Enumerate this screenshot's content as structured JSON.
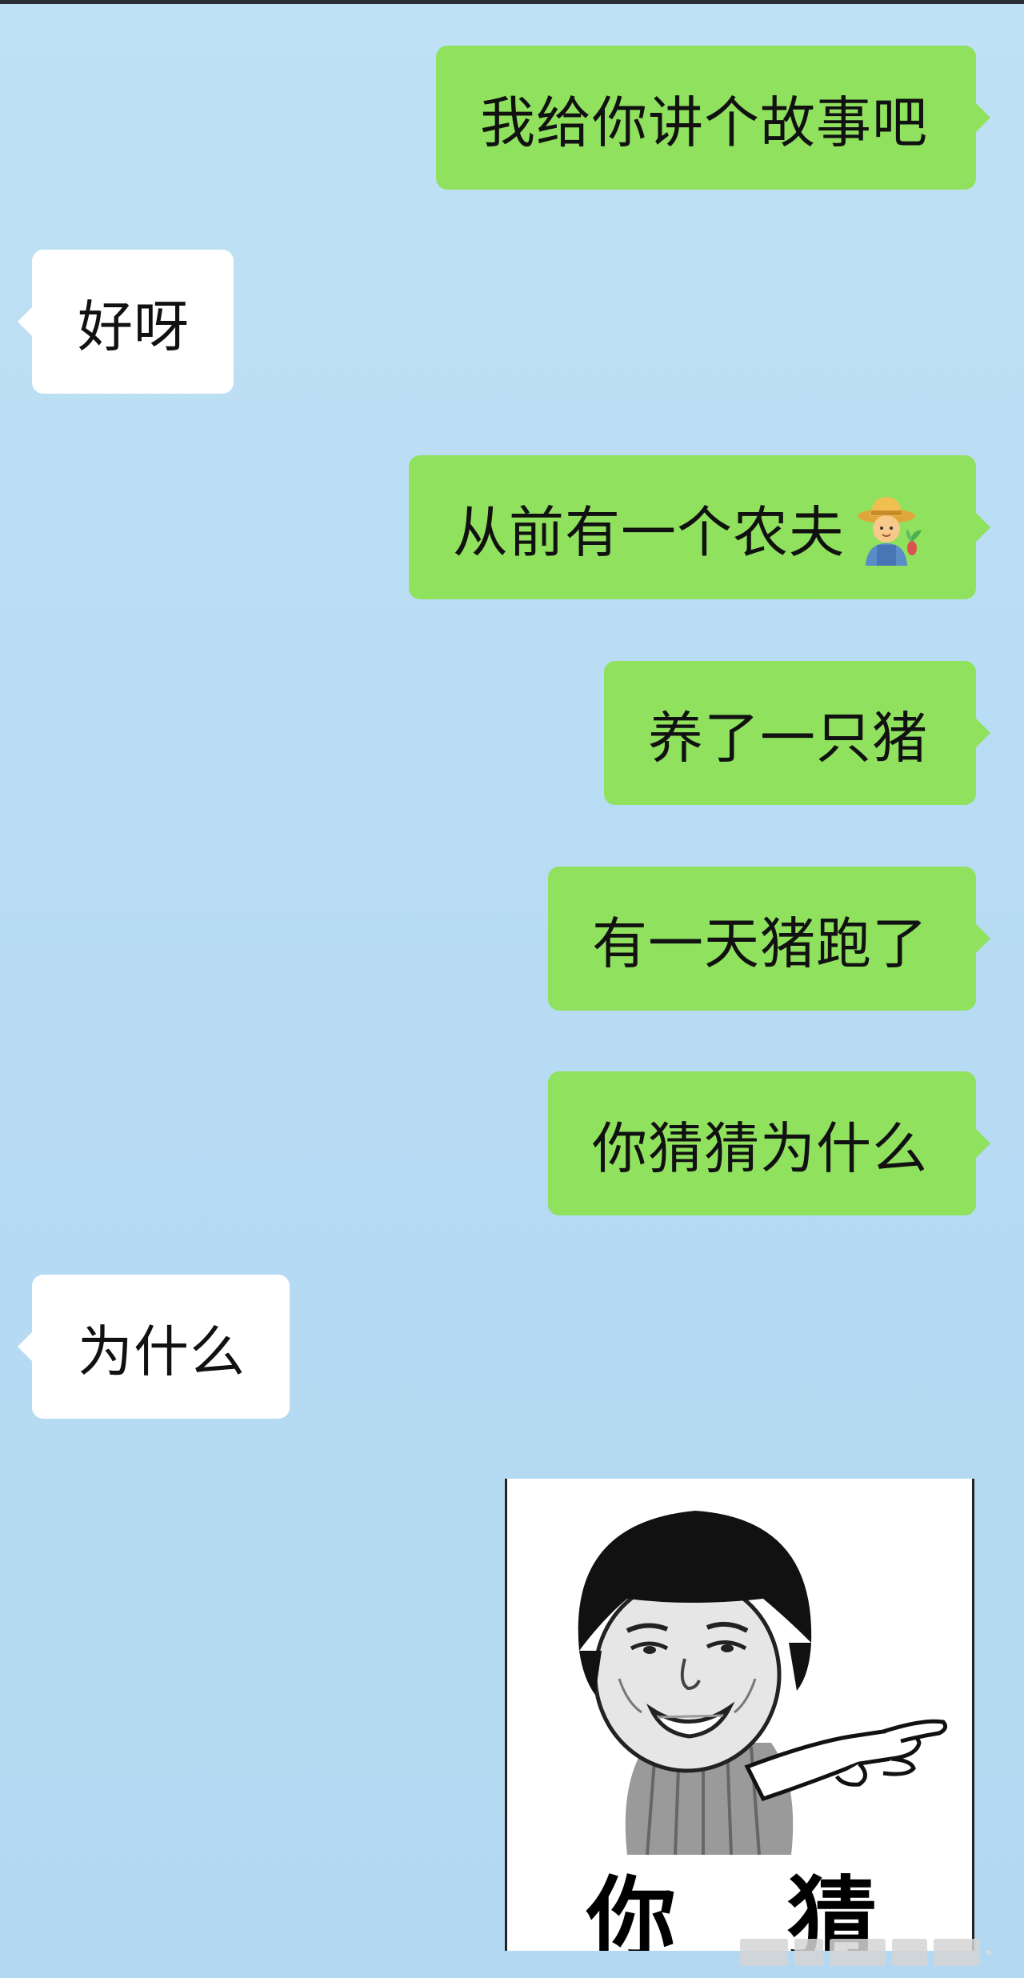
{
  "colors": {
    "background": "#b8dcf2",
    "outgoing_bubble": "#8fe15e",
    "incoming_bubble": "#ffffff"
  },
  "messages": [
    {
      "side": "out",
      "text": "我给你讲个故事吧"
    },
    {
      "side": "in",
      "text": "好呀"
    },
    {
      "side": "out",
      "text": "从前有一个农夫",
      "emoji": "farmer-emoji"
    },
    {
      "side": "out",
      "text": "养了一只猪"
    },
    {
      "side": "out",
      "text": "有一天猪跑了"
    },
    {
      "side": "out",
      "text": "你猜猜为什么"
    },
    {
      "side": "in",
      "text": "为什么"
    }
  ],
  "sticker": {
    "caption": "你 猜",
    "icon": "mushroom-head-pointing-sticker"
  }
}
